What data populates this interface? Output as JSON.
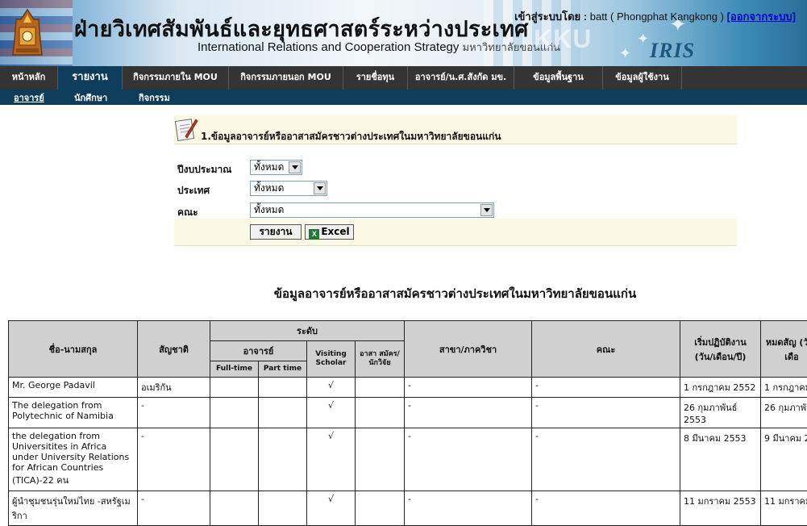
{
  "header": {
    "title_th": "ฝ่ายวิเทศสัมพันธ์และยุทธศาสตร์ระหว่างประเทศ",
    "title_en": "International Relations and Cooperation Strategy",
    "university": "มหาวิทยาลัยขอนแก่น",
    "login_prefix": "เข้าสู่ระบบโดย :",
    "login_user": "batt ( Phongphat Kangkong )",
    "logout": "[ออกจากระบบ]",
    "brand_kku": "KKU",
    "brand_iris": "IRIS"
  },
  "nav": {
    "items": [
      "หน้าหลัก",
      "รายงาน",
      "กิจกรรมภายใน MOU",
      "กิจกรรมภายนอก MOU",
      "รายชื่อทุน",
      "อาจารย์/น.ศ.สังกัด มข.",
      "ข้อมูลพื้นฐาน",
      "ข้อมูลผู้ใช้งาน"
    ],
    "active": "รายงาน",
    "subitems": [
      "อาจารย์",
      "นักศึกษา",
      "กิจกรรม"
    ],
    "active_sub": "อาจารย์"
  },
  "form": {
    "title": "1.ข้อมูลอาจารย์หรืออาสาสมัครชาวต่างประเทศในมหาวิทยาลัยขอนแก่น",
    "fields": [
      {
        "label": "ปีงบประมาณ",
        "value": "ทั้งหมด"
      },
      {
        "label": "ประเทศ",
        "value": "ทั้งหมด"
      },
      {
        "label": "คณะ",
        "value": "ทั้งหมด"
      }
    ],
    "report_button": "รายงาน",
    "excel_button": "Excel",
    "excel_icon": "excel-icon",
    "form_icon": "document-pen-icon"
  },
  "report": {
    "title": "ข้อมูลอาจารย์หรืออาสาสมัครชาวต่างประเทศในมหาวิทยาลัยขอนแก่น",
    "headers": {
      "name": "ชื่อ-นามสกุล",
      "nationality": "สัญชาติ",
      "level": "ระดับ",
      "lecturer": "อาจารย์",
      "fulltime": "Full-time",
      "parttime": "Part time",
      "visiting": "Visiting Scholar",
      "volunteer": "อาสา สมัคร/ นักวิจัย",
      "dept": "สาขา/ภาควิชา",
      "faculty": "คณะ",
      "start": "เริ่มปฏิบัติงาน (วัน/เดือน/ปี)",
      "end": "หมดสัญ (วัน/เดือ"
    },
    "rows": [
      {
        "name": "Mr. George Padavil",
        "nationality": "อเมริกัน",
        "fulltime": "",
        "parttime": "",
        "visiting": "√",
        "volunteer": "",
        "dept": "-",
        "faculty": "-",
        "start": "1 กรกฎาคม 2552",
        "end": "1 กรกฎาคม"
      },
      {
        "name": "The delegation from Polytechnic of Namibia",
        "nationality": "-",
        "fulltime": "",
        "parttime": "",
        "visiting": "√",
        "volunteer": "",
        "dept": "-",
        "faculty": "-",
        "start": "26 กุมภาพันธ์ 2553",
        "end": "26 กุมภาพัน"
      },
      {
        "name": "the delegation from Universitites in Africa under University Relations for African Countries (TICA)-22 คน",
        "nationality": "-",
        "fulltime": "",
        "parttime": "",
        "visiting": "√",
        "volunteer": "",
        "dept": "-",
        "faculty": "-",
        "start": "8 มีนาคม 2553",
        "end": "9 มีนาคม 2"
      },
      {
        "name": "ผู้นำชุมชนรุ่นใหม่ไทย -สหรัฐเมริกา",
        "nationality": "-",
        "fulltime": "",
        "parttime": "",
        "visiting": "√",
        "volunteer": "",
        "dept": "-",
        "faculty": "-",
        "start": "11 มกราคม 2553",
        "end": "11 มกราคม"
      }
    ]
  },
  "colors": {
    "nav_bg": "#343434",
    "nav_active": "#0e3d5c",
    "panel_bg": "#fbf8e4",
    "table_head": "#d0d0d0"
  }
}
